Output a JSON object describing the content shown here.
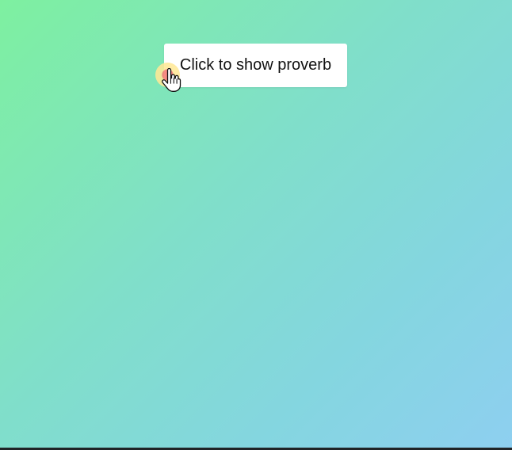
{
  "main": {
    "button_label": "Click to show proverb"
  },
  "icons": {
    "cursor": "hand-pointer-icon",
    "click_indicator": "click-ripple-icon"
  },
  "colors": {
    "gradient_start": "#7ef0a0",
    "gradient_middle": "#80dfc9",
    "gradient_end": "#8ecff0",
    "button_background": "#ffffff",
    "button_text": "#111111"
  }
}
